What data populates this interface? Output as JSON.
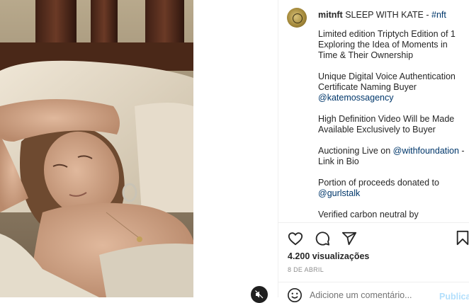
{
  "post": {
    "username": "mitnft",
    "title": "SLEEP WITH KATE",
    "separator": " - ",
    "hashtag": "#nft",
    "caption": {
      "p1": "Limited edition Triptych Edition of 1 Exploring the Idea of Moments in Time & Their Ownership",
      "p2_text": "Unique Digital Voice Authentication Certificate Naming Buyer",
      "p2_mention": "@katemossagency",
      "p3": "High Definition Video Will be Made Available Exclusively to Buyer",
      "p4_prefix": "Auctioning Live on ",
      "p4_mention": "@withfoundation",
      "p4_suffix": " - Link in Bio",
      "p5_text": "Portion of proceeds donated to",
      "p5_mention": "@gurlstalk",
      "p6": "Verified carbon neutral by"
    },
    "views": "4.200 visualizações",
    "date": "8 DE ABRIL"
  },
  "comment": {
    "placeholder": "Adicione um comentário...",
    "publish_label": "Publicar"
  },
  "icons": {
    "like": "heart-icon",
    "comment": "comment-bubble-icon",
    "share": "paper-plane-icon",
    "save": "bookmark-icon",
    "emoji": "smiley-icon",
    "mute": "speaker-muted-icon"
  }
}
